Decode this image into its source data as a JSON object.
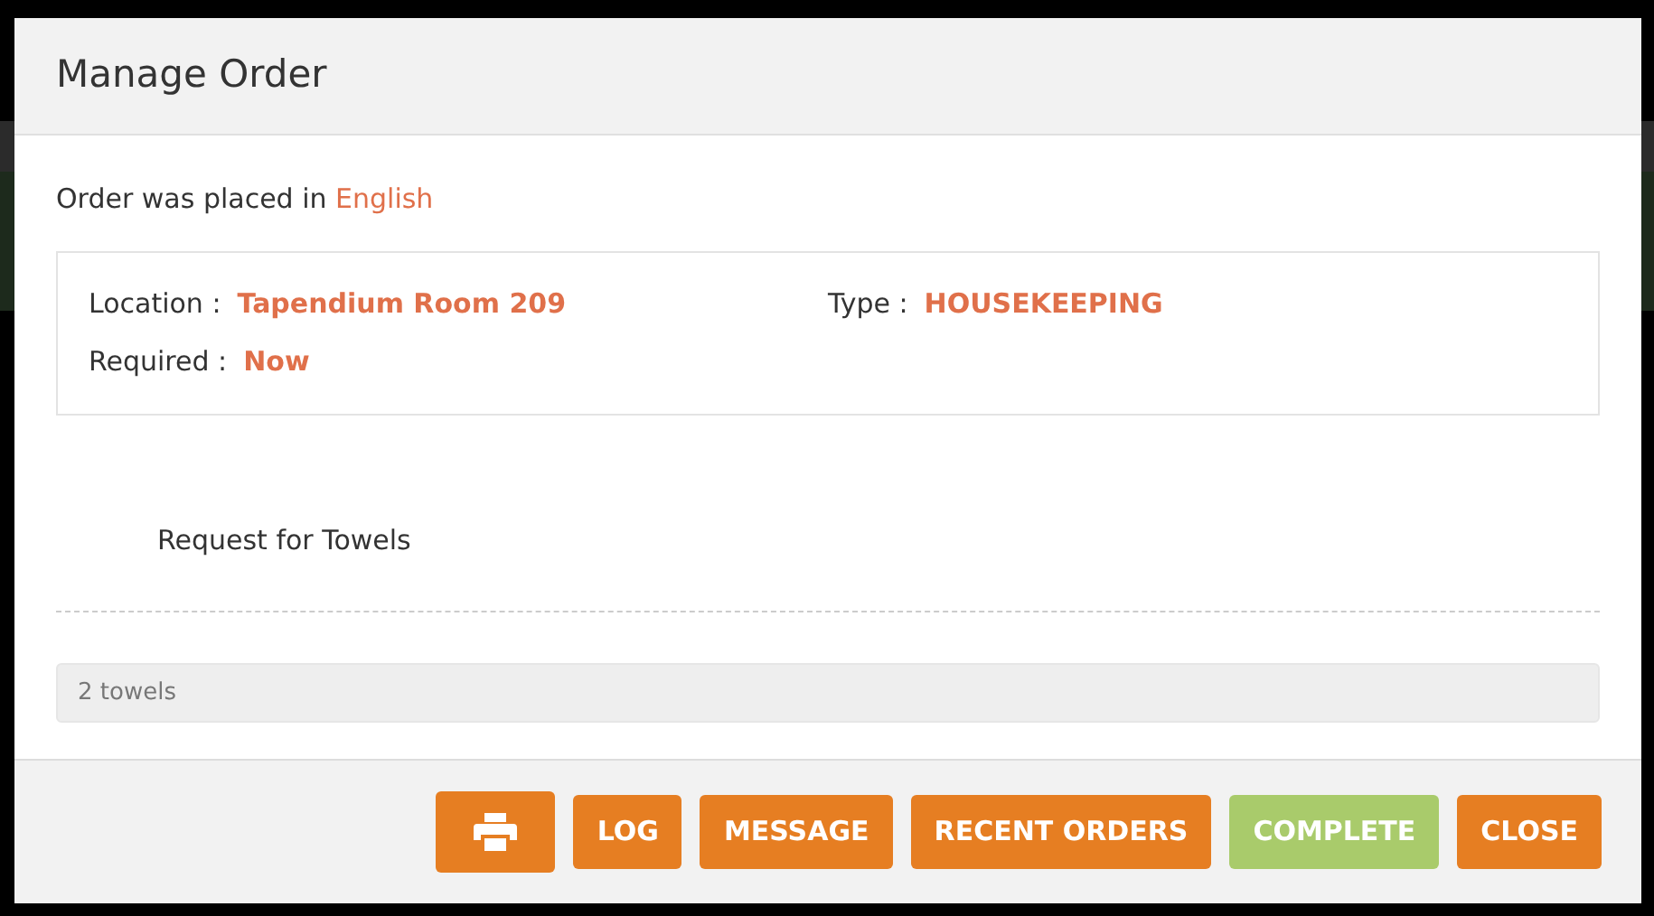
{
  "dialog": {
    "title": "Manage Order"
  },
  "language_line": {
    "label": "Order was placed in",
    "value": "English"
  },
  "details": [
    {
      "label": "Location :",
      "value": "Tapendium Room 209"
    },
    {
      "label": "Type :",
      "value": "HOUSEKEEPING"
    },
    {
      "label": "Required :",
      "value": "Now"
    }
  ],
  "request": "Request for Towels",
  "note": "2 towels",
  "buttons": [
    {
      "kind": "print",
      "color": "#e67e22"
    },
    {
      "kind": "text",
      "label": "LOG",
      "color": "#e67e22"
    },
    {
      "kind": "text",
      "label": "MESSAGE",
      "color": "#e67e22"
    },
    {
      "kind": "text",
      "label": "RECENT ORDERS",
      "color": "#e67e22"
    },
    {
      "kind": "text",
      "label": "COMPLETE",
      "color": "#a9cb6b"
    },
    {
      "kind": "text",
      "label": "CLOSE",
      "color": "#e67e22"
    }
  ]
}
